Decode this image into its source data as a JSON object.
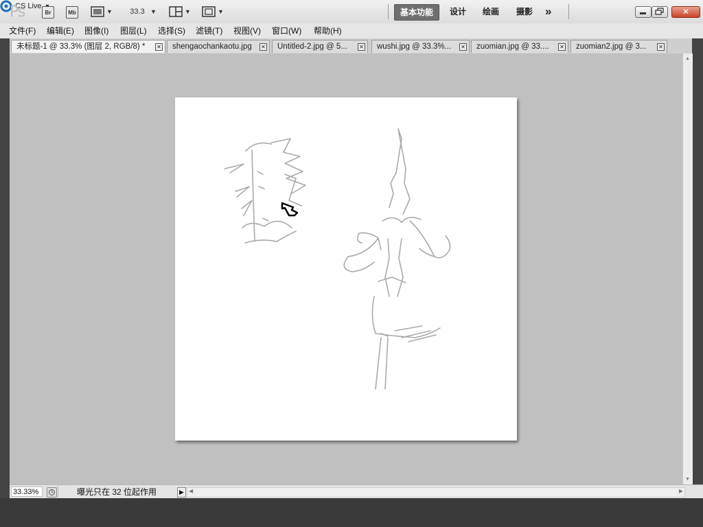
{
  "app": {
    "logo_text": "Ps",
    "bridge_label": "Br",
    "minibridge_label": "Mb",
    "zoom_value": "33.3",
    "workspaces": [
      "基本功能",
      "设计",
      "绘画",
      "摄影"
    ],
    "more_symbol": "»",
    "cs_live": "CS Live",
    "accent_active_workspace": "#6f6f6f"
  },
  "menu": {
    "items": [
      "文件(F)",
      "编辑(E)",
      "图像(I)",
      "图层(L)",
      "选择(S)",
      "滤镜(T)",
      "视图(V)",
      "窗口(W)",
      "帮助(H)"
    ]
  },
  "tabs": [
    {
      "label": "未标题-1 @ 33.3% (图层 2, RGB/8) *",
      "active": true
    },
    {
      "label": "shengaochankaotu.jpg",
      "active": false
    },
    {
      "label": "Untitled-2.jpg @ 5...",
      "active": false
    },
    {
      "label": "wushi.jpg @ 33.3%...",
      "active": false
    },
    {
      "label": "zuomian.jpg @ 33....",
      "active": false
    },
    {
      "label": "zuomian2.jpg @ 3...",
      "active": false
    }
  ],
  "status": {
    "zoom": "33.33%",
    "message": "曝光只在 32 位起作用"
  },
  "icons": {
    "tool_cursor": "hand-pointer-icon",
    "window_close": "close-icon"
  }
}
